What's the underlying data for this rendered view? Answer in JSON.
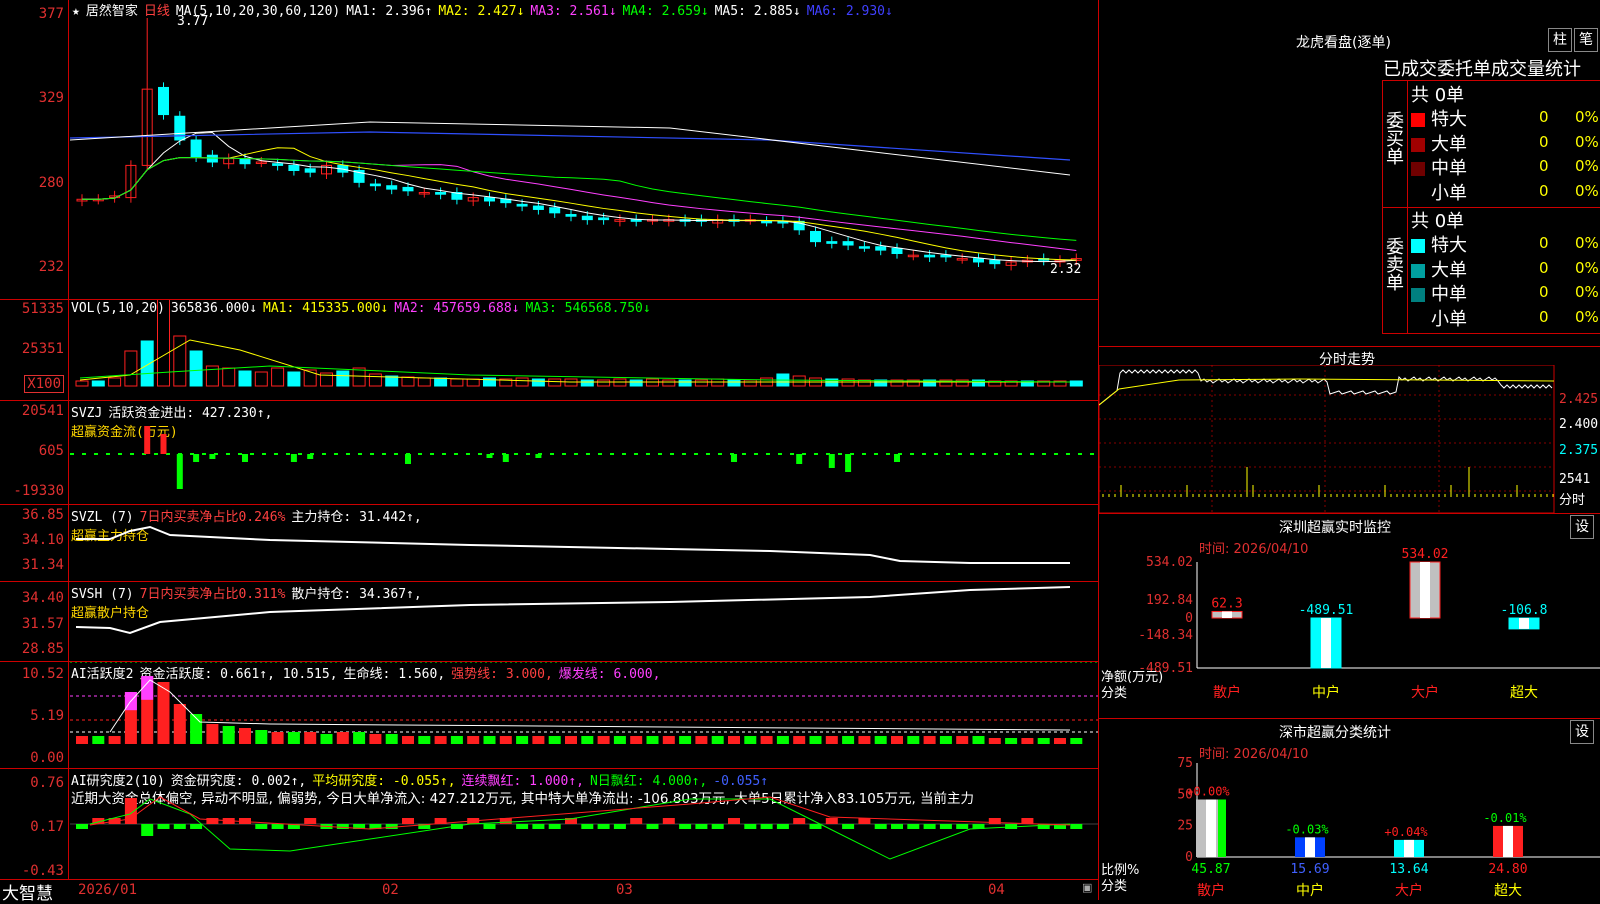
{
  "main": {
    "title": "居然智家",
    "period": "日线",
    "ma_label": "MA(5,10,20,30,60,120)",
    "ma": [
      {
        "label": "MA1: 2.396↑",
        "color": "#ffffff"
      },
      {
        "label": "MA2: 2.427↓",
        "color": "#ffff00"
      },
      {
        "label": "MA3: 2.561↓",
        "color": "#ff40ff"
      },
      {
        "label": "MA4: 2.659↓",
        "color": "#00ff00"
      },
      {
        "label": "MA5: 2.885↓",
        "color": "#ffffff"
      },
      {
        "label": "MA6: 2.930↓",
        "color": "#4040ff"
      }
    ],
    "high_label": "3.77",
    "low_label": "2.32",
    "yaxis": [
      "377",
      "329",
      "280",
      "232"
    ]
  },
  "vol": {
    "label": "VOL(5,10,20)",
    "value": "365836.000↓",
    "ma1": "MA1: 415335.000↓",
    "ma2": "MA2: 457659.688↓",
    "ma3": "MA3: 546568.750↓",
    "yaxis": [
      "51335",
      "25351",
      "X100"
    ]
  },
  "svzj": {
    "label": "SVZJ",
    "line1": "活跃资金进出: 427.230↑,",
    "line2": "超赢资金流(万元)",
    "yaxis": [
      "20541",
      "605",
      "-19330"
    ]
  },
  "svzl": {
    "label": "SVZL (7)",
    "desc": "7日内买卖净占比0.246%",
    "hold": "主力持仓: 31.442↑,",
    "line2": "超赢主力持仓",
    "yaxis": [
      "36.85",
      "34.10",
      "31.34"
    ]
  },
  "svsh": {
    "label": "SVSH (7)",
    "desc": "7日内买卖净占比0.311%",
    "hold": "散户持仓: 34.367↑,",
    "line2": "超赢散户持仓",
    "yaxis": [
      "34.40",
      "31.57",
      "28.85"
    ]
  },
  "ai1": {
    "label": "AI活跃度2",
    "act": "资金活跃度: 0.661↑, 10.515,",
    "life": "生命线: 1.560,",
    "strong": "强势线: 3.000,",
    "burst": "爆发线: 6.000,",
    "yaxis": [
      "10.52",
      "5.19",
      "0.00"
    ]
  },
  "ai2": {
    "label": "AI研究度2(10)",
    "res": "资金研究度: 0.002↑,",
    "avg": "平均研究度: -0.055↑,",
    "cont": "连续飘红: 1.000↑,",
    "nday": "N日飘红: 4.000↑,",
    "neg": "-0.055↑",
    "comment": "近期大资金总体偏空, 异动不明显, 偏弱势, 今日大单净流入: 427.212万元, 其中特大单净流出: -106.803万元, 大单5日累计净入83.105万元, 当前主力",
    "yaxis": [
      "0.76",
      "0.17",
      "-0.43"
    ]
  },
  "xaxis": [
    "2026/01",
    "02",
    "03",
    "04"
  ],
  "bottom_brand": "大智慧",
  "right": {
    "title": "龙虎看盘(逐单)",
    "btn_bar": "柱",
    "btn_pen": "笔",
    "tabs": "已成交委托单成交量统计",
    "buy_total": "共 0单",
    "buy_label": "委买单",
    "sell_total": "共 0单",
    "sell_label": "委卖单",
    "buy_rows": [
      {
        "name": "特大",
        "count": "0",
        "pct": "0%",
        "color": "#ff0000"
      },
      {
        "name": "大单",
        "count": "0",
        "pct": "0%",
        "color": "#a00000"
      },
      {
        "name": "中单",
        "count": "0",
        "pct": "0%",
        "color": "#700000"
      },
      {
        "name": "小单",
        "count": "0",
        "pct": "0%",
        "color": "#000000"
      }
    ],
    "sell_rows": [
      {
        "name": "特大",
        "count": "0",
        "pct": "0%",
        "color": "#00ffff"
      },
      {
        "name": "大单",
        "count": "0",
        "pct": "0%",
        "color": "#00a0a0"
      },
      {
        "name": "中单",
        "count": "0",
        "pct": "0%",
        "color": "#008080"
      },
      {
        "name": "小单",
        "count": "0",
        "pct": "0%",
        "color": "#000000"
      }
    ],
    "intraday_title": "分时走势",
    "intraday_y": [
      "2.425",
      "2.400",
      "2.375"
    ],
    "intraday_vol": "2541",
    "intraday_unit": "分时",
    "sz_title": "深圳超赢实时监控",
    "sz_set": "设",
    "sz_time": "时间: 2026/04/10",
    "sz_y": [
      "534.02",
      "192.84",
      "0",
      "-148.34",
      "-489.51"
    ],
    "sz_unit": "净额(万元)",
    "sz_class": "分类",
    "sz_bars": [
      {
        "cat": "散户",
        "value": 62.3,
        "label": "62.3"
      },
      {
        "cat": "中户",
        "value": -489.51,
        "label": "-489.51"
      },
      {
        "cat": "大户",
        "value": 534.02,
        "label": "534.02"
      },
      {
        "cat": "超大",
        "value": -106.8,
        "label": "-106.8"
      }
    ],
    "cls_title": "深市超赢分类统计",
    "cls_set": "设",
    "cls_time": "时间: 2026/04/10",
    "cls_y": [
      "75",
      "50",
      "25",
      "0"
    ],
    "cls_unit": "比例%",
    "cls_class": "分类",
    "cls_bars": [
      {
        "cat": "散户",
        "value": 45.87,
        "label": "45.87",
        "delta": "+0.00%"
      },
      {
        "cat": "中户",
        "value": 15.69,
        "label": "15.69",
        "delta": "-0.03%"
      },
      {
        "cat": "大户",
        "value": 13.64,
        "label": "13.64",
        "delta": "+0.04%"
      },
      {
        "cat": "超大",
        "value": 24.8,
        "label": "24.80",
        "delta": "-0.01%"
      }
    ]
  }
}
